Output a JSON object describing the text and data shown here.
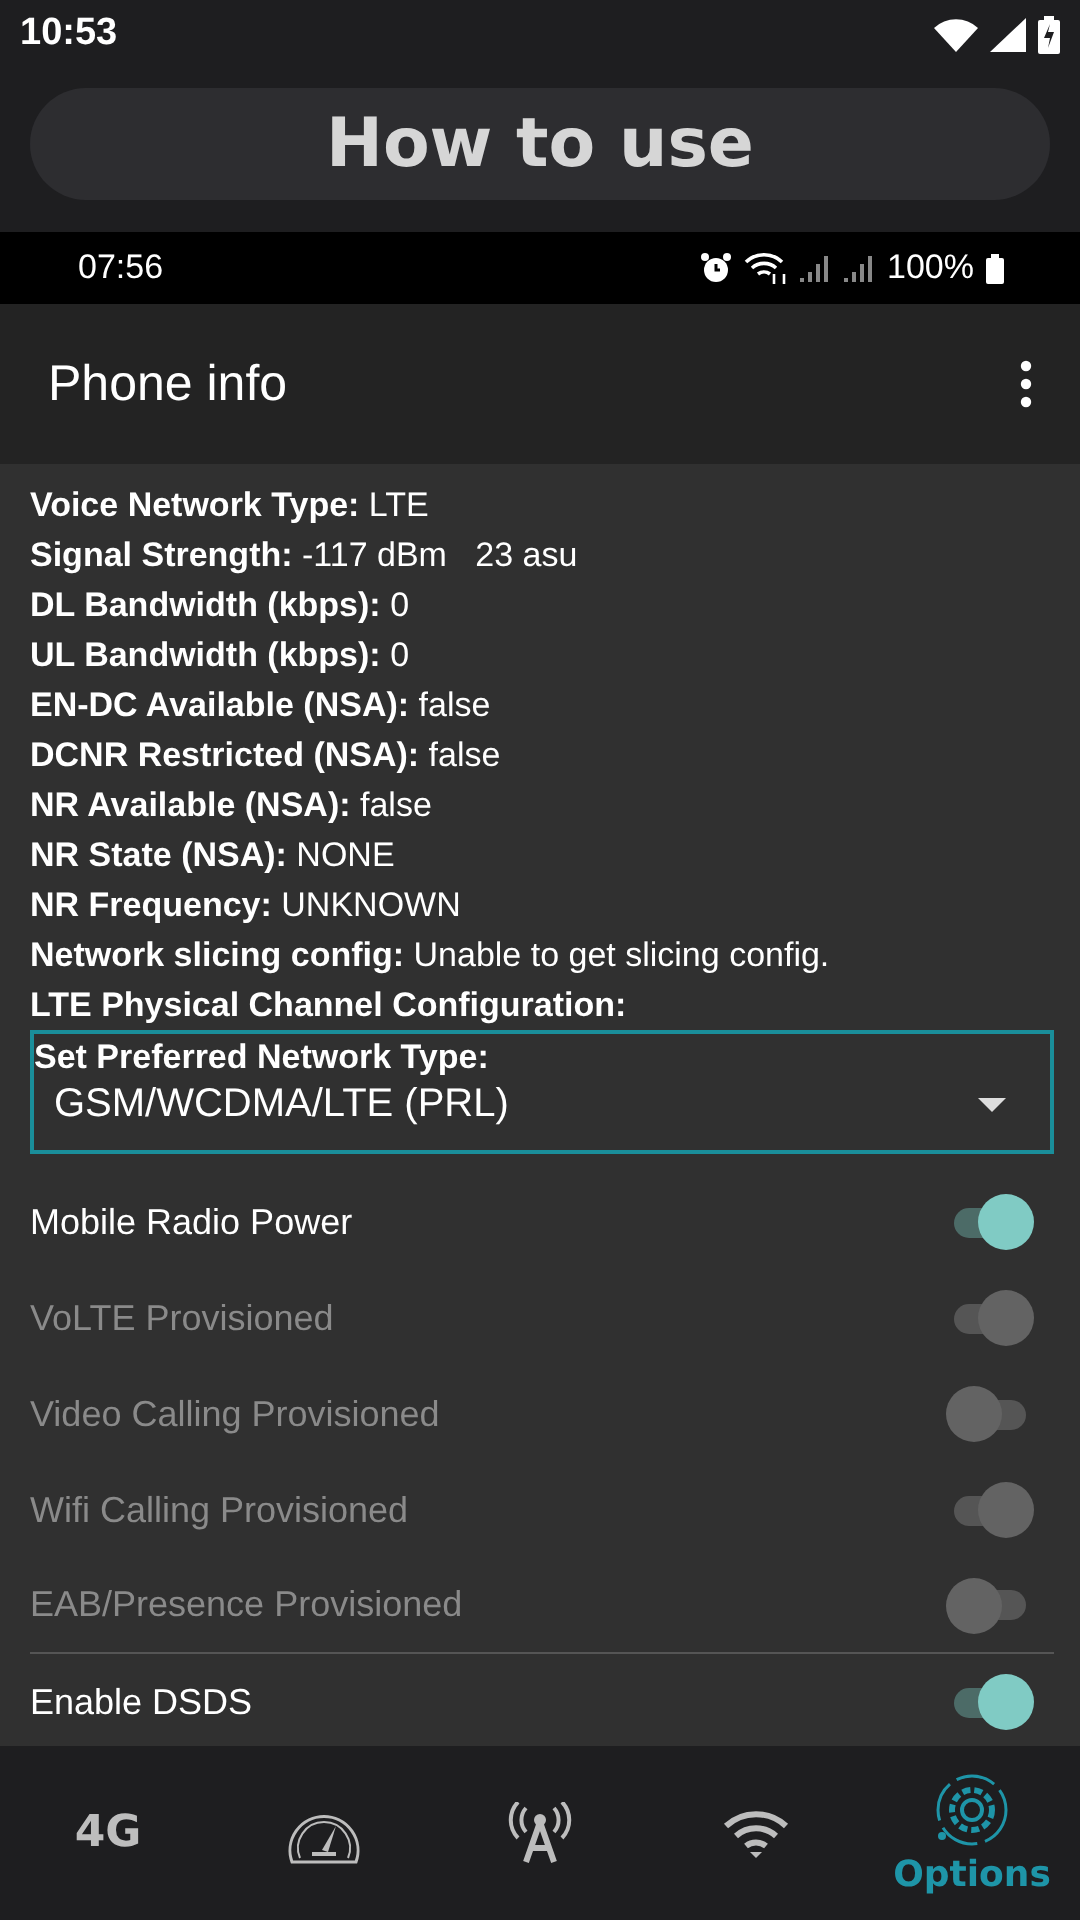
{
  "status_bar": {
    "time": "10:53"
  },
  "how_to_button": {
    "label": "How to use"
  },
  "inner_status_bar": {
    "time": "07:56",
    "battery": "100%"
  },
  "app_bar": {
    "title": "Phone info"
  },
  "info_rows": [
    {
      "label": "Voice Network Type:",
      "value": "LTE"
    },
    {
      "label": "Signal Strength:",
      "value": "-117 dBm   23 asu"
    },
    {
      "label": "DL Bandwidth (kbps):",
      "value": "0"
    },
    {
      "label": "UL Bandwidth (kbps):",
      "value": "0"
    },
    {
      "label": "EN-DC Available (NSA):",
      "value": "false"
    },
    {
      "label": "DCNR Restricted (NSA):",
      "value": "false"
    },
    {
      "label": "NR Available (NSA):",
      "value": "false"
    },
    {
      "label": "NR State (NSA):",
      "value": "NONE"
    },
    {
      "label": "NR Frequency:",
      "value": "UNKNOWN"
    },
    {
      "label": "Network slicing config:",
      "value": "Unable to get slicing config."
    },
    {
      "label": "LTE Physical Channel Configuration:"
    }
  ],
  "network_type": {
    "label": "Set Preferred Network Type:",
    "value": "GSM/WCDMA/LTE (PRL)"
  },
  "switches": [
    {
      "label": "Mobile Radio Power",
      "on": true,
      "disabled": false
    },
    {
      "label": "VoLTE Provisioned",
      "on": true,
      "disabled": true
    },
    {
      "label": "Video Calling Provisioned",
      "on": false,
      "disabled": true
    },
    {
      "label": "Wifi Calling Provisioned",
      "on": true,
      "disabled": true
    },
    {
      "label": "EAB/Presence Provisioned",
      "on": false,
      "disabled": true,
      "divider": true
    },
    {
      "label": "Enable DSDS",
      "on": true,
      "disabled": false
    }
  ],
  "bottom_nav": [
    {
      "kind": "text",
      "label": "4G",
      "selected": false
    },
    {
      "kind": "gauge",
      "selected": false
    },
    {
      "kind": "antenna",
      "selected": false
    },
    {
      "kind": "wifi",
      "selected": false
    },
    {
      "kind": "gear",
      "label": "Options",
      "selected": true
    }
  ]
}
